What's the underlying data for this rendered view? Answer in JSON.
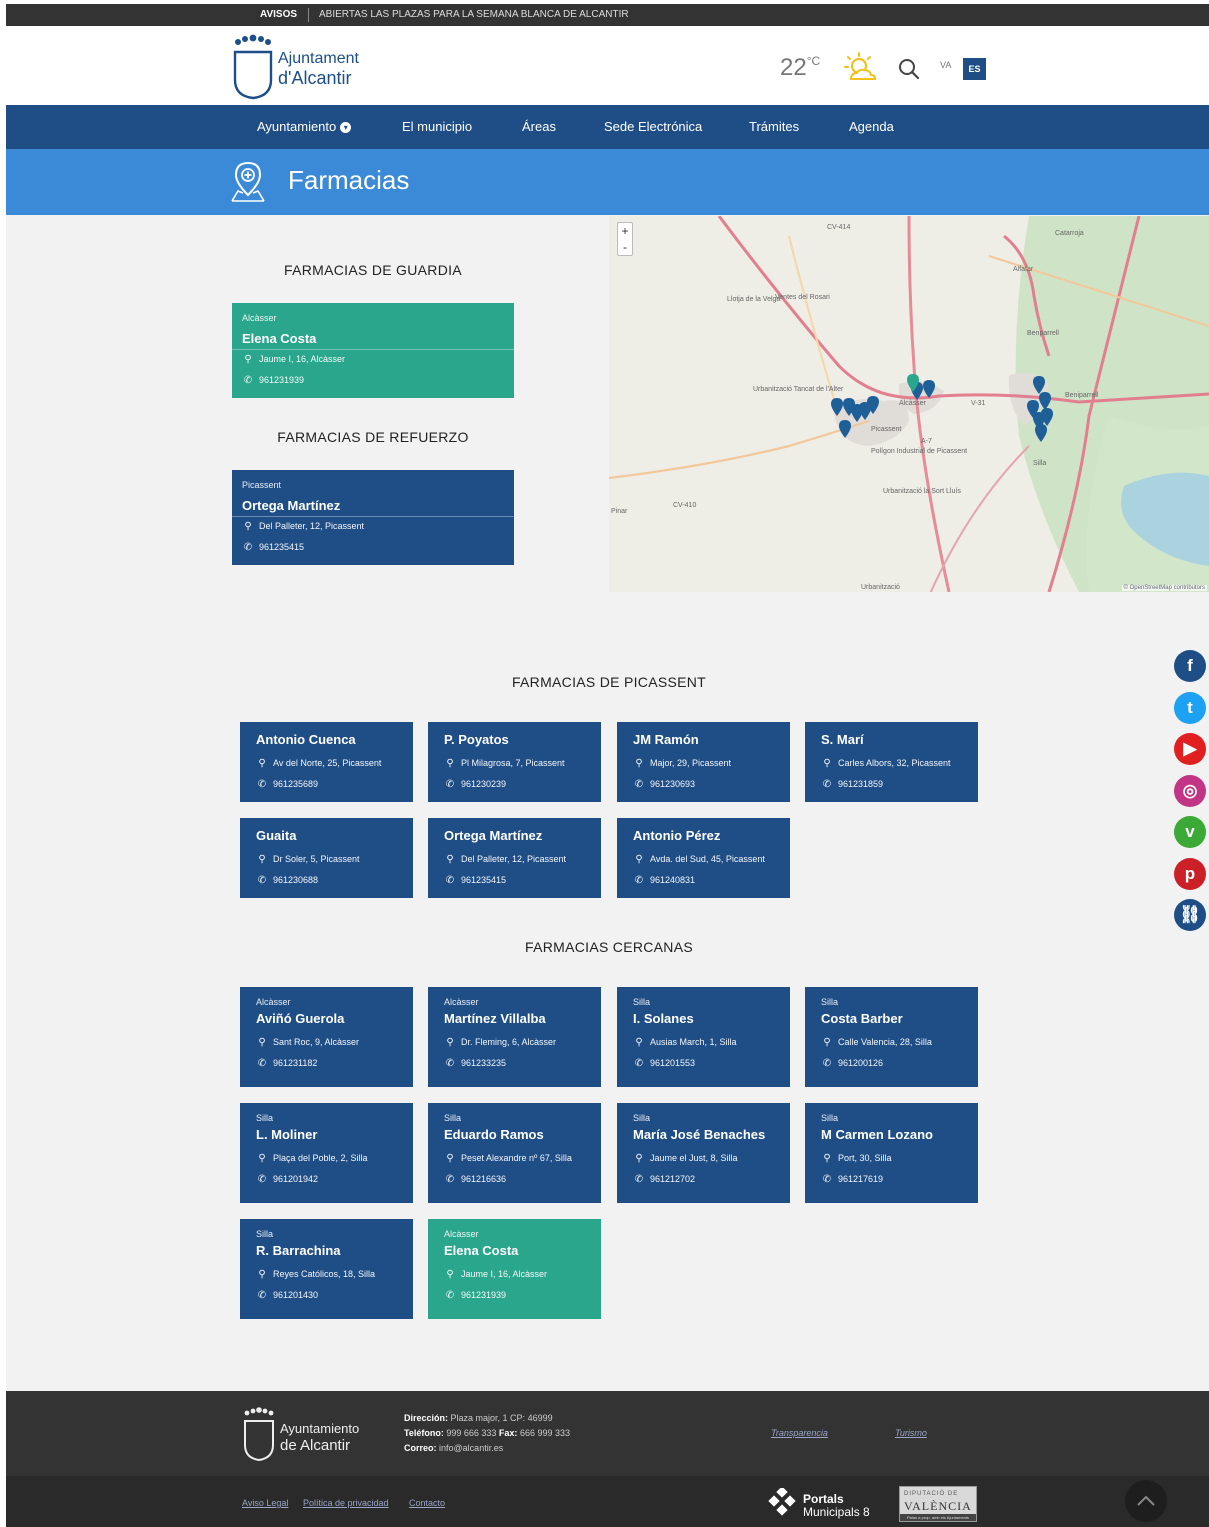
{
  "alert": {
    "label": "AVISOS",
    "text": "ABIERTAS LAS PLAZAS PARA LA SEMANA BLANCA DE ALCANTIR"
  },
  "header": {
    "logo_line1": "Ajuntament",
    "logo_line2": "d'Alcantir",
    "temperature": "22",
    "temp_unit": "°C",
    "weather_icon": "sun-cloud-icon",
    "lang_va": "VA",
    "lang_es": "ES"
  },
  "nav": {
    "items": [
      {
        "label": "Ayuntamiento"
      },
      {
        "label": "El municipio"
      },
      {
        "label": "Áreas"
      },
      {
        "label": "Sede Electrónica"
      },
      {
        "label": "Trámites"
      },
      {
        "label": "Agenda"
      }
    ]
  },
  "page": {
    "title": "Farmacias"
  },
  "sections": {
    "guardia": "FARMACIAS DE GUARDIA",
    "refuerzo": "FARMACIAS DE REFUERZO",
    "picassent": "FARMACIAS DE PICASSENT",
    "cercanas": "FARMACIAS CERCANAS"
  },
  "guardia": {
    "town": "Alcàsser",
    "name": "Elena Costa",
    "address": "Jaume I, 16, Alcàsser",
    "phone": "961231939"
  },
  "refuerzo": {
    "town": "Picassent",
    "name": "Ortega Martínez",
    "address": "Del Palleter, 12, Picassent",
    "phone": "961235415"
  },
  "picassent": [
    {
      "name": "Antonio Cuenca",
      "address": "Av del Norte, 25, Picassent",
      "phone": "961235689"
    },
    {
      "name": "P. Poyatos",
      "address": "Pl Milagrosa, 7, Picassent",
      "phone": "961230239"
    },
    {
      "name": "JM Ramón",
      "address": "Major, 29, Picassent",
      "phone": "961230693"
    },
    {
      "name": "S. Marí",
      "address": "Carles Albors, 32, Picassent",
      "phone": "961231859"
    },
    {
      "name": "Guaita",
      "address": "Dr Soler, 5, Picassent",
      "phone": "961230688"
    },
    {
      "name": "Ortega Martínez",
      "address": "Del Palleter, 12, Picassent",
      "phone": "961235415"
    },
    {
      "name": "Antonio Pérez",
      "address": "Avda. del Sud, 45, Picassent",
      "phone": "961240831"
    }
  ],
  "cercanas": [
    {
      "town": "Alcàsser",
      "name": "Aviñó Guerola",
      "address": "Sant Roc, 9, Alcàsser",
      "phone": "961231182"
    },
    {
      "town": "Alcàsser",
      "name": "Martínez Villalba",
      "address": "Dr. Fleming, 6, Alcàsser",
      "phone": "961233235"
    },
    {
      "town": "Silla",
      "name": "I. Solanes",
      "address": "Ausias March, 1, Silla",
      "phone": "961201553"
    },
    {
      "town": "Silla",
      "name": "Costa Barber",
      "address": "Calle Valencia, 28, Silla",
      "phone": "961200126"
    },
    {
      "town": "Silla",
      "name": "L. Moliner",
      "address": "Plaça del Poble, 2, Silla",
      "phone": "961201942"
    },
    {
      "town": "Silla",
      "name": "Eduardo Ramos",
      "address": "Peset Alexandre nº 67, Silla",
      "phone": "961216636"
    },
    {
      "town": "Silla",
      "name": "María José Benaches",
      "address": "Jaume el Just, 8, Silla",
      "phone": "961212702"
    },
    {
      "town": "Silla",
      "name": "M Carmen Lozano",
      "address": "Port, 30, Silla",
      "phone": "961217619"
    },
    {
      "town": "Silla",
      "name": "R. Barrachina",
      "address": "Reyes Católicos, 18, Silla",
      "phone": "961201430"
    },
    {
      "town": "Alcàsser",
      "name": "Elena Costa",
      "address": "Jaume I, 16, Alcàsser",
      "phone": "961231939"
    }
  ],
  "map": {
    "zoom_in": "+",
    "zoom_out": "-",
    "labels": [
      "CV-414",
      "Catarroja",
      "Alfafar",
      "Benparrell",
      "Llotja de la Velga",
      "Ventes del Rosari",
      "Urbanització Tancat de l'Alter",
      "Picassent",
      "Alcàsser",
      "Polígon Industrial de Picassent",
      "Urbanització la Sort Lluís",
      "Beniparrell",
      "Silla",
      "Urbanització",
      "Pinar",
      "CV-410",
      "V-31",
      "A-7"
    ],
    "attribution": "© OpenStreetMap contributors"
  },
  "social": [
    {
      "icon": "facebook-icon",
      "glyph": "f",
      "color": "#1f4e87"
    },
    {
      "icon": "twitter-icon",
      "glyph": "t",
      "color": "#1da1f2"
    },
    {
      "icon": "youtube-icon",
      "glyph": "▶",
      "color": "#e02020"
    },
    {
      "icon": "instagram-icon",
      "glyph": "◎",
      "color": "#c13584"
    },
    {
      "icon": "vimeo-icon",
      "glyph": "v",
      "color": "#3aa936"
    },
    {
      "icon": "pinterest-icon",
      "glyph": "p",
      "color": "#cb2027"
    },
    {
      "icon": "link-icon",
      "glyph": "⛓",
      "color": "#1f4e87"
    }
  ],
  "footer": {
    "logo_line1": "Ayuntamiento",
    "logo_line2": "de Alcantir",
    "address_label": "Dirección:",
    "address": "Plaza major, 1 CP: 46999",
    "phone_label": "Teléfono:",
    "phone": "999 666 333",
    "fax_label": "Fax:",
    "fax": "666 999 333",
    "email_label": "Correo:",
    "email": "info@alcantir.es",
    "links": [
      "Transparencia",
      "Turismo"
    ],
    "legal": [
      "Aviso Legal",
      "Política de privacidad",
      "Contacto"
    ],
    "portals_line1": "Portals",
    "portals_line2": "Municipals 8",
    "dipu_top": "DIPUTACIÓ DE",
    "dipu_main": "VALÈNCIA",
    "dipu_sub": "Palau a prop, amb els Ajuntaments"
  }
}
